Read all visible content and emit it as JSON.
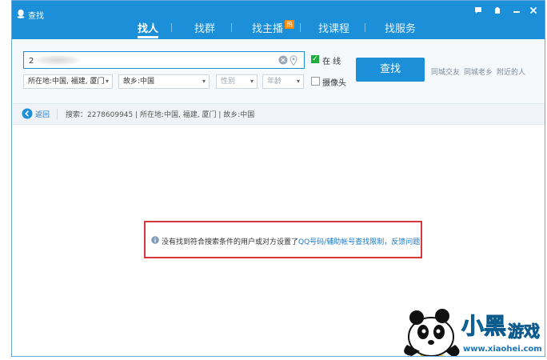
{
  "window": {
    "title": "查找"
  },
  "tabs": [
    {
      "label": "找人",
      "active": true
    },
    {
      "label": "找群",
      "active": false
    },
    {
      "label": "找主播",
      "badge": "热",
      "active": false
    },
    {
      "label": "找课程",
      "active": false
    },
    {
      "label": "找服务",
      "active": false
    }
  ],
  "window_controls": [
    "message-icon",
    "skin-icon",
    "minimize-icon",
    "close-icon"
  ],
  "search": {
    "value": "2        9",
    "placeholder": ""
  },
  "filters": {
    "location": "所在地:中国, 福建, 厦门",
    "hometown": "故乡:中国",
    "gender_placeholder": "性别",
    "age_placeholder": "年龄",
    "online_label": "在 线",
    "online_checked": true,
    "camera_label": "摄像头",
    "camera_checked": false
  },
  "find_button": "查找",
  "quick_links": [
    "同城交友",
    "同城老乡",
    "附近的人"
  ],
  "breadcrumb": {
    "back_label": "返回",
    "text": "搜索：2278609945 | 所在地:中国, 福建, 厦门 | 故乡:中国"
  },
  "notice": {
    "message": "没有找到符合搜索条件的用户或对方设置了",
    "link": "QQ号码/辅助帐号查找限制，反馈问题"
  },
  "watermark": {
    "brand": "小黑游戏",
    "url": "www.xiaohei.com"
  },
  "colors": {
    "titlebar": "#1b8fd8",
    "accent": "#1b8fd8",
    "notice_border": "#d9363e",
    "online_check": "#1bae3b",
    "link": "#1b78c8"
  }
}
